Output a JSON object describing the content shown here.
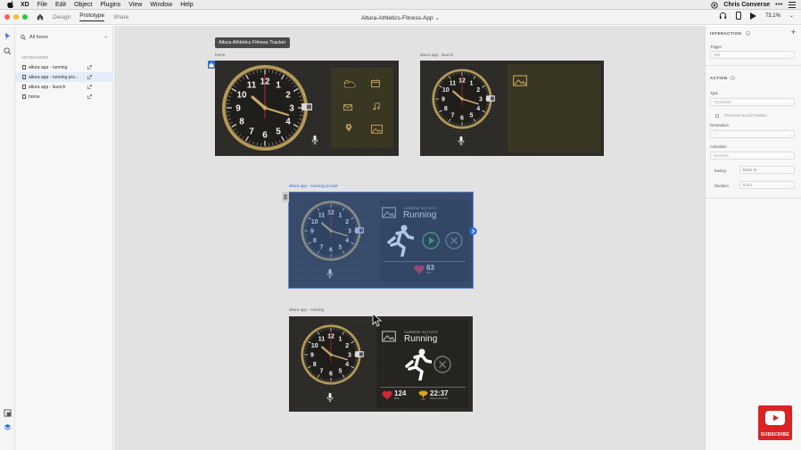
{
  "menubar": {
    "app": "XD",
    "items": [
      "File",
      "Edit",
      "Object",
      "Plugins",
      "View",
      "Window",
      "Help"
    ],
    "user": "Chris Converse"
  },
  "appbar": {
    "tabs": [
      "Design",
      "Prototype",
      "Share"
    ],
    "active_tab": "Prototype",
    "document_title": "Altura-Athletics-Fitness-App",
    "zoom": "73.1%"
  },
  "layers_panel": {
    "search_label": "All Items",
    "section_title": "ARTBOARDS",
    "artboards": [
      "altura app - running",
      "altura app - running pro...",
      "altura app - launch",
      "home"
    ],
    "selected_index": 1
  },
  "canvas": {
    "tooltip": "Altura Athletics Fitness Tracker",
    "artboards": {
      "home": {
        "label": "home"
      },
      "launch": {
        "label": "altura app - launch"
      },
      "prompt": {
        "label": "altura app - running prompt",
        "activity_caption": "CURRENT ACTIVITY",
        "activity": "Running",
        "heart_rate": "63",
        "heart_unit": "BPM"
      },
      "running": {
        "label": "altura app - running",
        "activity_caption": "CURRENT ACTIVITY",
        "activity": "Running",
        "heart_rate": "124",
        "heart_unit": "BPM",
        "best_time": "22:37",
        "best_caption": "PERSONAL BEST"
      }
    },
    "clock_numbers": [
      "12",
      "1",
      "2",
      "3",
      "4",
      "5",
      "6",
      "7",
      "8",
      "9",
      "10",
      "11"
    ]
  },
  "properties": {
    "interaction_title": "INTERACTION",
    "trigger_label": "Trigger",
    "trigger_value": "Tap",
    "action_title": "ACTION",
    "type_label": "Type",
    "type_value": "Transition",
    "preserve_scroll": "Preserve Scroll Position",
    "destination_label": "Destination",
    "destination_value": "---",
    "animation_label": "Animation",
    "animation_value": "Dissolve",
    "easing_label": "Easing",
    "easing_value": "Ease In",
    "duration_label": "Duration",
    "duration_value": "0.3 s"
  },
  "youtube": {
    "label": "SUBSCRIBE"
  },
  "colors": {
    "accent": "#2d6fd8",
    "selection": "#4b78c8",
    "gold": "#b59a5a",
    "running_green": "#38b54a",
    "heart_red": "#d0283a",
    "trophy_gold": "#d9a628",
    "subscribe_red": "#d92424"
  }
}
